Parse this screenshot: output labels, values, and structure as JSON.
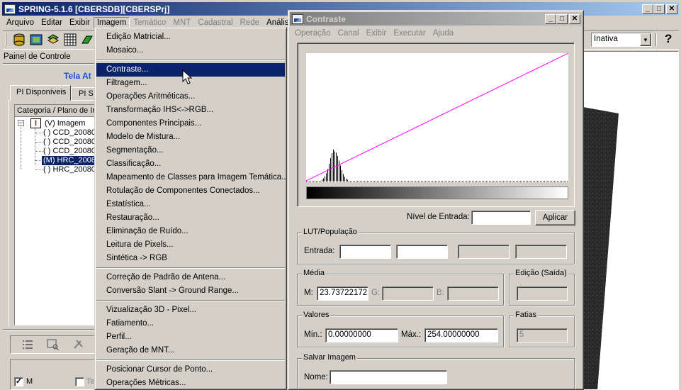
{
  "main_window": {
    "title": "SPRING-5.1.6 [CBERSDB][CBERSPrj]",
    "menu": [
      "Arquivo",
      "Editar",
      "Exibir",
      "Imagem",
      "Temático",
      "MNT",
      "Cadastral",
      "Rede",
      "Análise"
    ],
    "active_menu": "Imagem",
    "disabled_menus": [
      "Temático",
      "MNT",
      "Cadastral",
      "Rede"
    ],
    "toolbar_select_value": "Inativa",
    "help_glyph": "?"
  },
  "control_panel": {
    "title": "Painel de Controle",
    "subtitle": "Tela At",
    "tabs": [
      "PI Disponíveis",
      "PI S"
    ],
    "list_header": "Categoria / Plano de In",
    "tree": [
      {
        "label": "(V) Imagem",
        "level": 0,
        "selected": false
      },
      {
        "label": "( ) CCD_20080",
        "level": 1,
        "selected": false
      },
      {
        "label": "( ) CCD_20080",
        "level": 1,
        "selected": false
      },
      {
        "label": "( ) CCD_20080",
        "level": 1,
        "selected": false
      },
      {
        "label": "(M) HRC_2008",
        "level": 1,
        "selected": true
      },
      {
        "label": "( ) HRC_20080",
        "level": 1,
        "selected": false
      }
    ],
    "check_m_label": "M",
    "check_m_checked": true,
    "check_te_label": "Te"
  },
  "imagem_menu": {
    "groups": [
      [
        "Edição Matricial...",
        "Mosaico..."
      ],
      [
        "Contraste...",
        "Filtragem...",
        "Operações Aritméticas...",
        "Transformação IHS<->RGB...",
        "Componentes Principais...",
        "Modelo de Mistura...",
        "Segmentação...",
        "Classificação...",
        "Mapeamento de Classes para Imagem Temática...",
        "Rotulação de Componentes Conectados...",
        "Estatística...",
        "Restauração...",
        "Eliminação de Ruído...",
        "Leitura de Pixels...",
        "Sintética -> RGB"
      ],
      [
        "Correção de Padrão de Antena...",
        "Conversão Slant -> Ground Range..."
      ],
      [
        "Vizualização 3D - Pixel...",
        "Fatiamento...",
        "Perfil...",
        "Geração de MNT..."
      ],
      [
        "Posicionar Cursor de Ponto...",
        "Operações Métricas..."
      ]
    ],
    "highlighted": "Contraste..."
  },
  "contraste_dialog": {
    "title": "Contraste",
    "menu": [
      "Operação",
      "Canal",
      "Exibir",
      "Executar",
      "Ajuda"
    ],
    "nivel_entrada_label": "Nível de Entrada:",
    "nivel_entrada_value": "",
    "aplicar_label": "Aplicar",
    "lut_group": "LUT/População",
    "entrada_label": "Entrada:",
    "media_group": "Média",
    "m_label": "M:",
    "m_value": "23.73722172",
    "g_label": "G:",
    "b_label": "B:",
    "edicao_group": "Edição (Saída)",
    "valores_group": "Valores",
    "min_label": "Mín.:",
    "min_value": "0.00000000",
    "max_label": "Máx.:",
    "max_value": "254.00000000",
    "fatias_group": "Fatias",
    "fatias_value": "5",
    "salvar_group": "Salvar Imagem",
    "nome_label": "Nome:",
    "nome_value": ""
  },
  "colors": {
    "title_active": "#0a246a",
    "menu_highlight": "#0a246a",
    "lut_line": "#ff00ff"
  }
}
